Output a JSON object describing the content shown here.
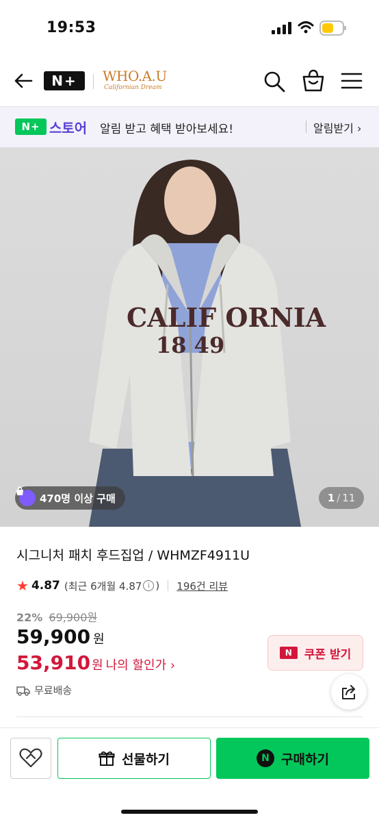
{
  "status_bar": {
    "time": "19:53"
  },
  "header": {
    "nplus_logo": "N+",
    "brand_line1": "WHO.A.U",
    "brand_line2": "Californian Dream"
  },
  "banner": {
    "badge": "N+",
    "store_name": "스토어",
    "message": "알림 받고 혜택 받아보세요!",
    "cta": "알림받기 ›"
  },
  "hero": {
    "buyers": "470명 이상 구매",
    "counter_current": "1",
    "counter_sep": "/",
    "counter_total": "11",
    "print_line1": "CALIF ORNIA",
    "print_line2": "18  49"
  },
  "product": {
    "title": "시그니처 패치 후드집업 / WHMZF4911U",
    "rating": "4.87",
    "rating_recent": "(최근 6개월 4.87",
    "rating_recent_close": ")",
    "reviews": "196건 리뷰",
    "discount_pct": "22%",
    "original_price": "69,900원",
    "price": "59,900",
    "price_unit": "원",
    "my_price": "53,910",
    "my_price_unit": "원",
    "my_price_label": "나의 할인가 ›",
    "shipping": "무료배송"
  },
  "coupon": {
    "badge": "N",
    "label": "쿠폰 받기"
  },
  "bottom_bar": {
    "gift_label": "선물하기",
    "buy_label": "구매하기",
    "buy_logo": "N"
  },
  "colors": {
    "naver_green": "#03c75a",
    "sale_red": "#d3173b",
    "store_purple": "#5a3fd3",
    "brand_orange": "#c87c2a"
  }
}
